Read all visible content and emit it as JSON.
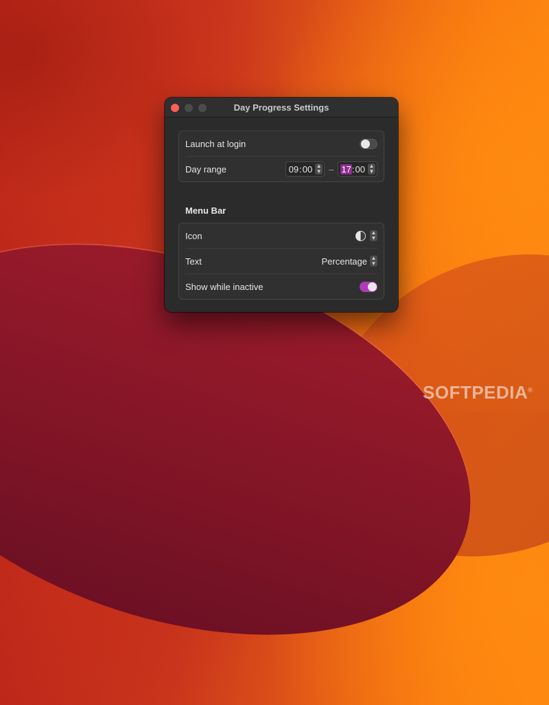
{
  "window": {
    "title": "Day Progress Settings"
  },
  "general": {
    "launch_at_login": {
      "label": "Launch at login",
      "enabled": false
    },
    "day_range": {
      "label": "Day range",
      "start_hour": "09",
      "start_minute": "00",
      "separator": ":",
      "dash": "–",
      "end_hour": "17",
      "end_minute": "00"
    }
  },
  "menu_bar": {
    "section_title": "Menu Bar",
    "icon": {
      "label": "Icon",
      "value_icon": "half-pie-icon"
    },
    "text": {
      "label": "Text",
      "value": "Percentage"
    },
    "show_while_inactive": {
      "label": "Show while inactive",
      "enabled": true
    }
  },
  "colors": {
    "accent": "#b13ab7",
    "close": "#fe5f57",
    "window_bg": "#2b2b2b"
  },
  "watermark": {
    "text": "SOFTPEDIA",
    "mark": "®"
  }
}
